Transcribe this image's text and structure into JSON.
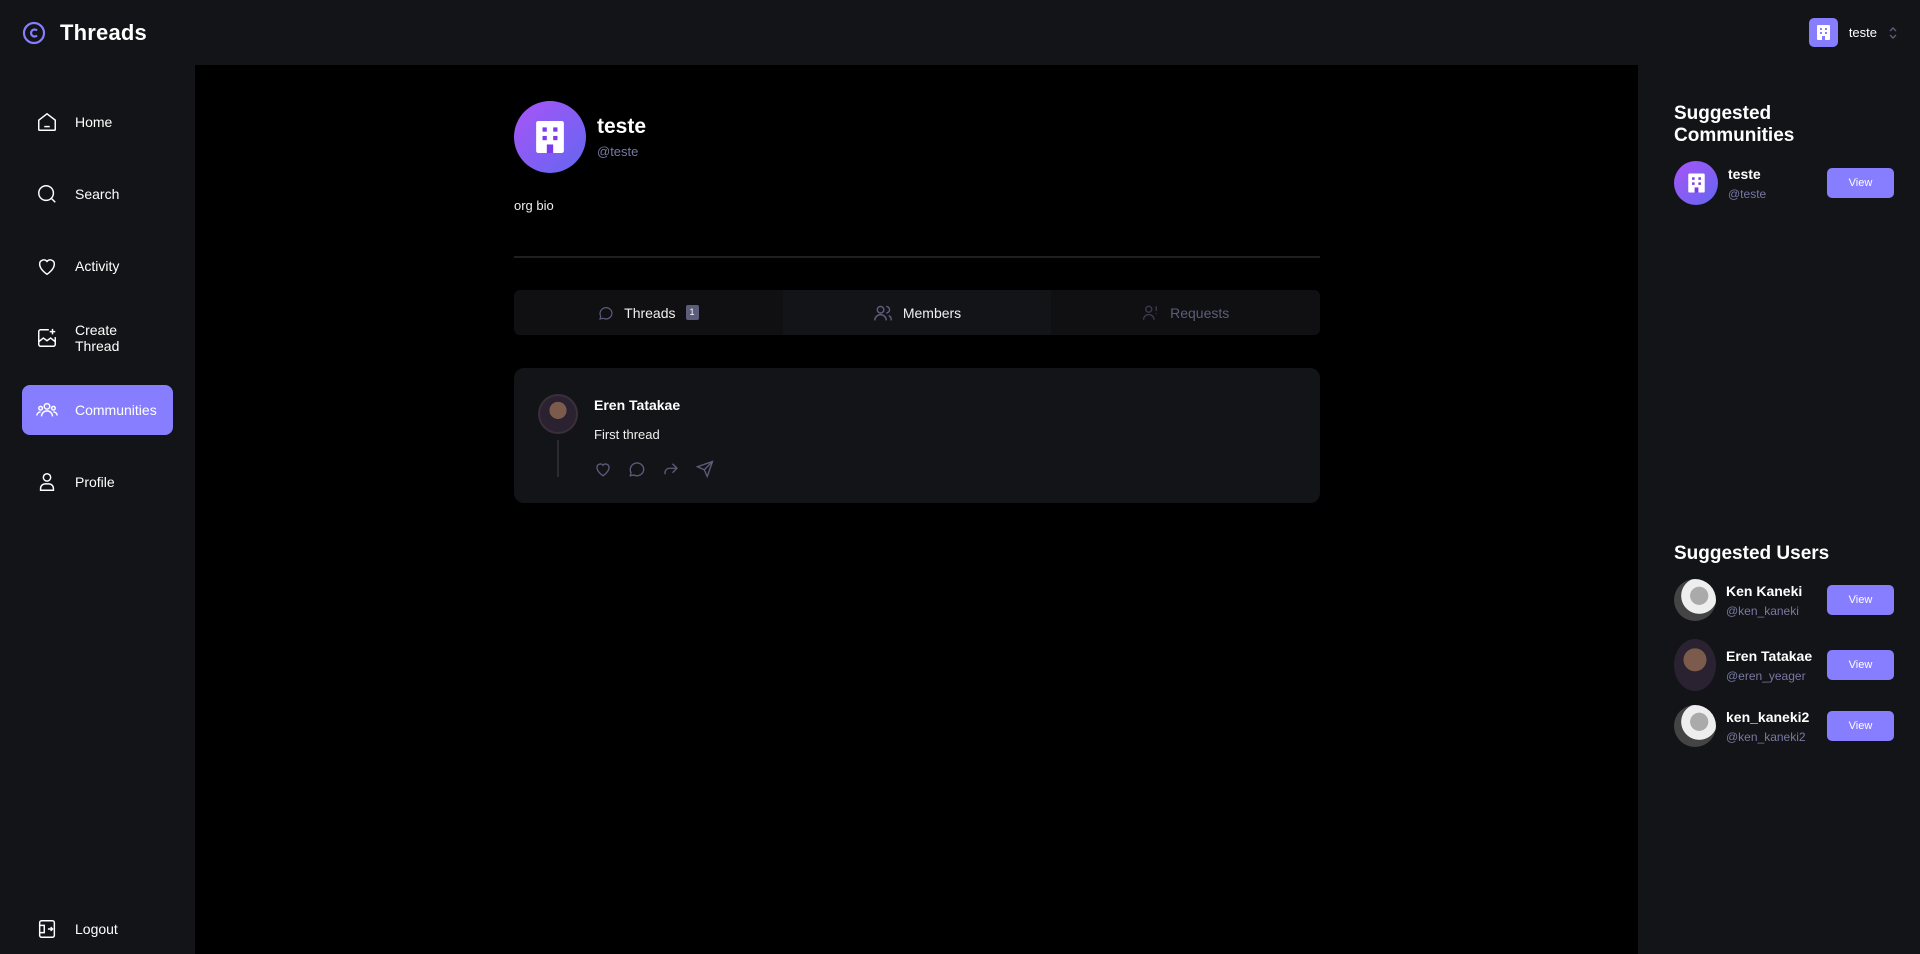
{
  "topbar": {
    "app_name": "Threads",
    "org_name": "teste"
  },
  "nav": {
    "items": [
      {
        "label": "Home"
      },
      {
        "label": "Search"
      },
      {
        "label": "Activity"
      },
      {
        "label": "Create Thread"
      },
      {
        "label": "Communities"
      },
      {
        "label": "Profile"
      }
    ],
    "logout": "Logout",
    "active": "Communities"
  },
  "community": {
    "name": "teste",
    "handle": "@teste",
    "bio": "org bio"
  },
  "tabs": [
    {
      "label": "Threads",
      "count": "1"
    },
    {
      "label": "Members"
    },
    {
      "label": "Requests"
    }
  ],
  "thread": {
    "author": "Eren Tatakae",
    "text": "First thread"
  },
  "suggested_communities": {
    "title": "Suggested Communities",
    "items": [
      {
        "name": "teste",
        "handle": "@teste",
        "button": "View"
      }
    ]
  },
  "suggested_users": {
    "title": "Suggested Users",
    "items": [
      {
        "name": "Ken Kaneki",
        "handle": "@ken_kaneki",
        "button": "View"
      },
      {
        "name": "Eren Tatakae",
        "handle": "@eren_yeager",
        "button": "View"
      },
      {
        "name": "ken_kaneki2",
        "handle": "@ken_kaneki2",
        "button": "View"
      }
    ]
  },
  "colors": {
    "accent": "#877eff",
    "panel": "#121417",
    "muted": "#7878a3",
    "bg": "#000000"
  }
}
